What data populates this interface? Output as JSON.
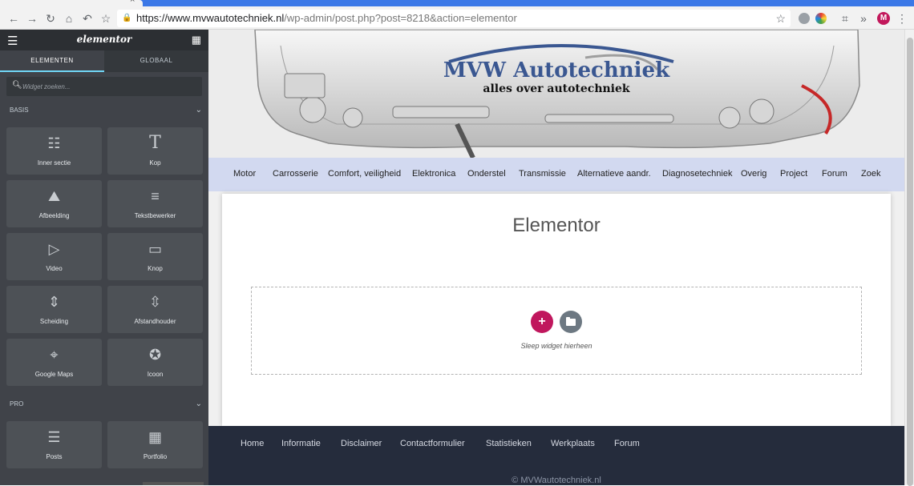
{
  "browser": {
    "url_host": "https://www.mvwautotechniek.nl",
    "url_path": "/wp-admin/post.php?post=8218&action=elementor",
    "avatar_letter": "M"
  },
  "panel": {
    "logo": "elementor",
    "tabs": [
      "ELEMENTEN",
      "GLOBAAL"
    ],
    "search_placeholder": "Widget zoeken...",
    "categories": [
      {
        "label": "BASIS",
        "widgets": [
          {
            "label": "Inner sectie",
            "icon": "columns-icon"
          },
          {
            "label": "Kop",
            "icon": "heading-icon"
          },
          {
            "label": "Afbeelding",
            "icon": "image-icon"
          },
          {
            "label": "Tekstbewerker",
            "icon": "text-editor-icon"
          },
          {
            "label": "Video",
            "icon": "video-icon"
          },
          {
            "label": "Knop",
            "icon": "button-icon"
          },
          {
            "label": "Scheiding",
            "icon": "divider-icon"
          },
          {
            "label": "Afstandhouder",
            "icon": "spacer-icon"
          },
          {
            "label": "Google Maps",
            "icon": "map-icon"
          },
          {
            "label": "Icoon",
            "icon": "star-icon"
          }
        ]
      },
      {
        "label": "PRO",
        "widgets": [
          {
            "label": "Posts",
            "icon": "posts-icon"
          },
          {
            "label": "Portfolio",
            "icon": "portfolio-icon"
          }
        ]
      }
    ]
  },
  "site": {
    "title": "MVW Autotechniek",
    "tagline": "alles over autotechniek",
    "nav": [
      "Motor",
      "Carrosserie",
      "Comfort, veiligheid",
      "Elektronica",
      "Onderstel",
      "Transmissie",
      "Alternatieve aandr.",
      "Diagnosetechniek",
      "Overig",
      "Project",
      "Forum",
      "Zoek"
    ],
    "page_title": "Elementor",
    "drop_text": "Sleep widget hierheen",
    "footer_links": [
      "Home",
      "Informatie",
      "Disclaimer",
      "Contactformulier",
      "Statistieken",
      "Werkplaats",
      "Forum"
    ],
    "copyright": "© MVWautotechniek.nl"
  },
  "colors": {
    "accent": "#c0175d",
    "panel_bg": "#404349",
    "nav_bg": "#d2d9f0",
    "footer_bg": "#252c3c",
    "tab_underline": "#71d7f7"
  }
}
